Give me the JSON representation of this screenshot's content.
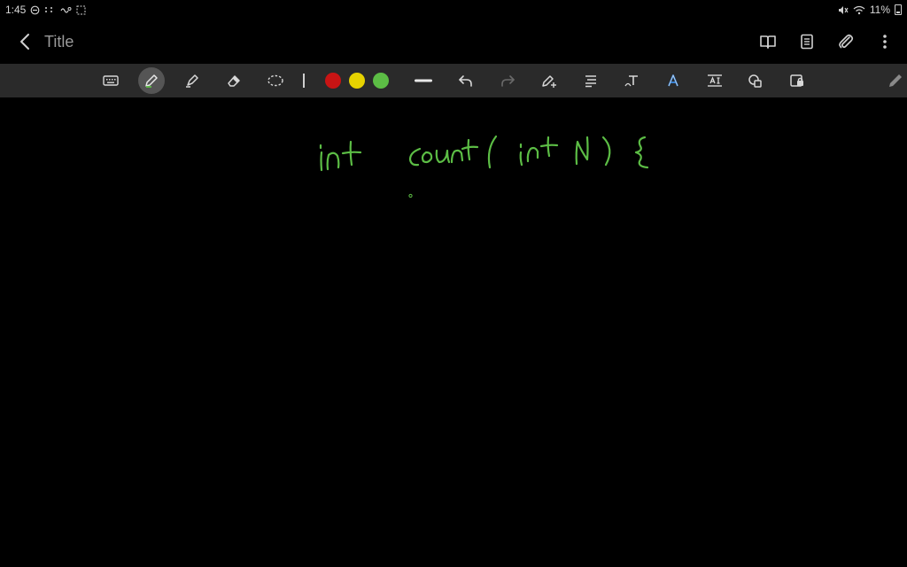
{
  "status": {
    "time": "1:45",
    "battery": "11%"
  },
  "header": {
    "title": "Title"
  },
  "toolbar": {
    "active_tool": "pen",
    "colors": [
      "#c81414",
      "#e6d200",
      "#5cbd45"
    ]
  },
  "canvas": {
    "ink_color": "#5cbd45"
  }
}
